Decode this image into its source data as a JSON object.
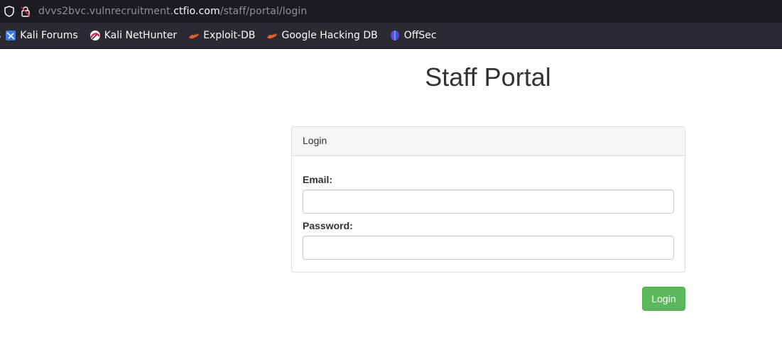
{
  "browser": {
    "url": {
      "prefix": "dvvs2bvc.vulnrecruitment.",
      "domain": "ctfio.com",
      "path": "/staff/portal/login"
    },
    "bookmarks": [
      {
        "label": "s",
        "icon": "kali-icon"
      },
      {
        "label": "Kali Forums",
        "icon": "kali-forums-icon"
      },
      {
        "label": "Kali NetHunter",
        "icon": "kali-nethunter-icon"
      },
      {
        "label": "Exploit-DB",
        "icon": "exploit-db-icon"
      },
      {
        "label": "Google Hacking DB",
        "icon": "ghdb-icon"
      },
      {
        "label": "OffSec",
        "icon": "offsec-icon"
      }
    ]
  },
  "page": {
    "title": "Staff Portal",
    "panel_heading": "Login",
    "email_label": "Email:",
    "email_value": "",
    "password_label": "Password:",
    "password_value": "",
    "submit_label": "Login"
  },
  "colors": {
    "button": "#5cb85c",
    "panel_heading_bg": "#f5f5f5",
    "browser_chrome": "#1c1b22",
    "bookmarks_bar": "#2b2a33"
  }
}
